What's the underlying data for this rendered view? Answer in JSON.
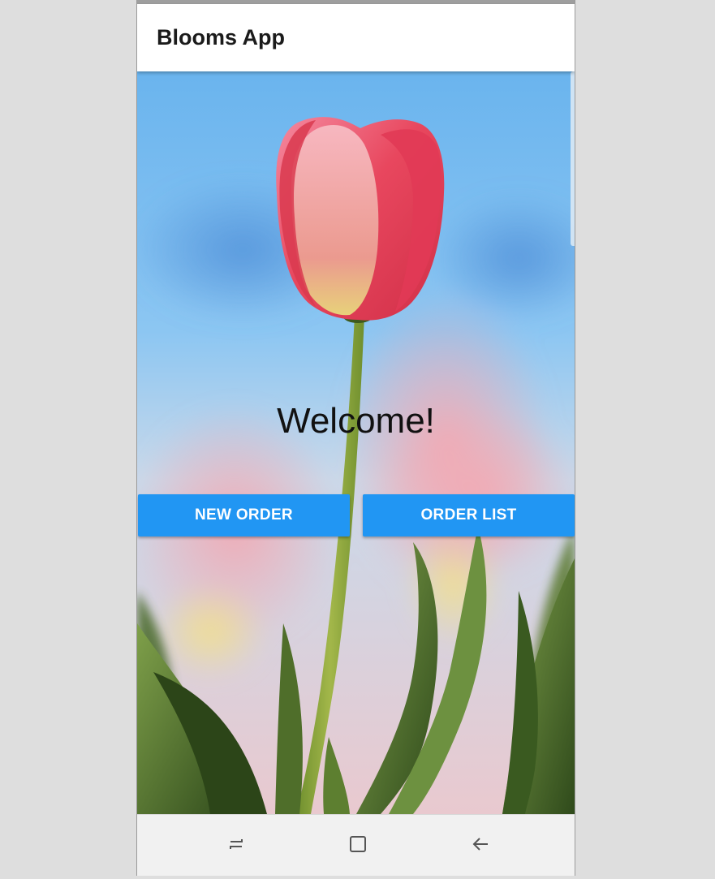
{
  "app_bar": {
    "title": "Blooms App"
  },
  "main": {
    "welcome_text": "Welcome!",
    "background": "tulip-photo",
    "buttons": {
      "new_order": "NEW ORDER",
      "order_list": "ORDER LIST"
    }
  },
  "nav_bar": {
    "icons": [
      "recent-apps-icon",
      "home-icon",
      "back-icon"
    ]
  },
  "colors": {
    "button": "#2196f3",
    "button_text": "#ffffff",
    "app_bar": "#ffffff",
    "nav_bar": "#f1f1f1"
  }
}
